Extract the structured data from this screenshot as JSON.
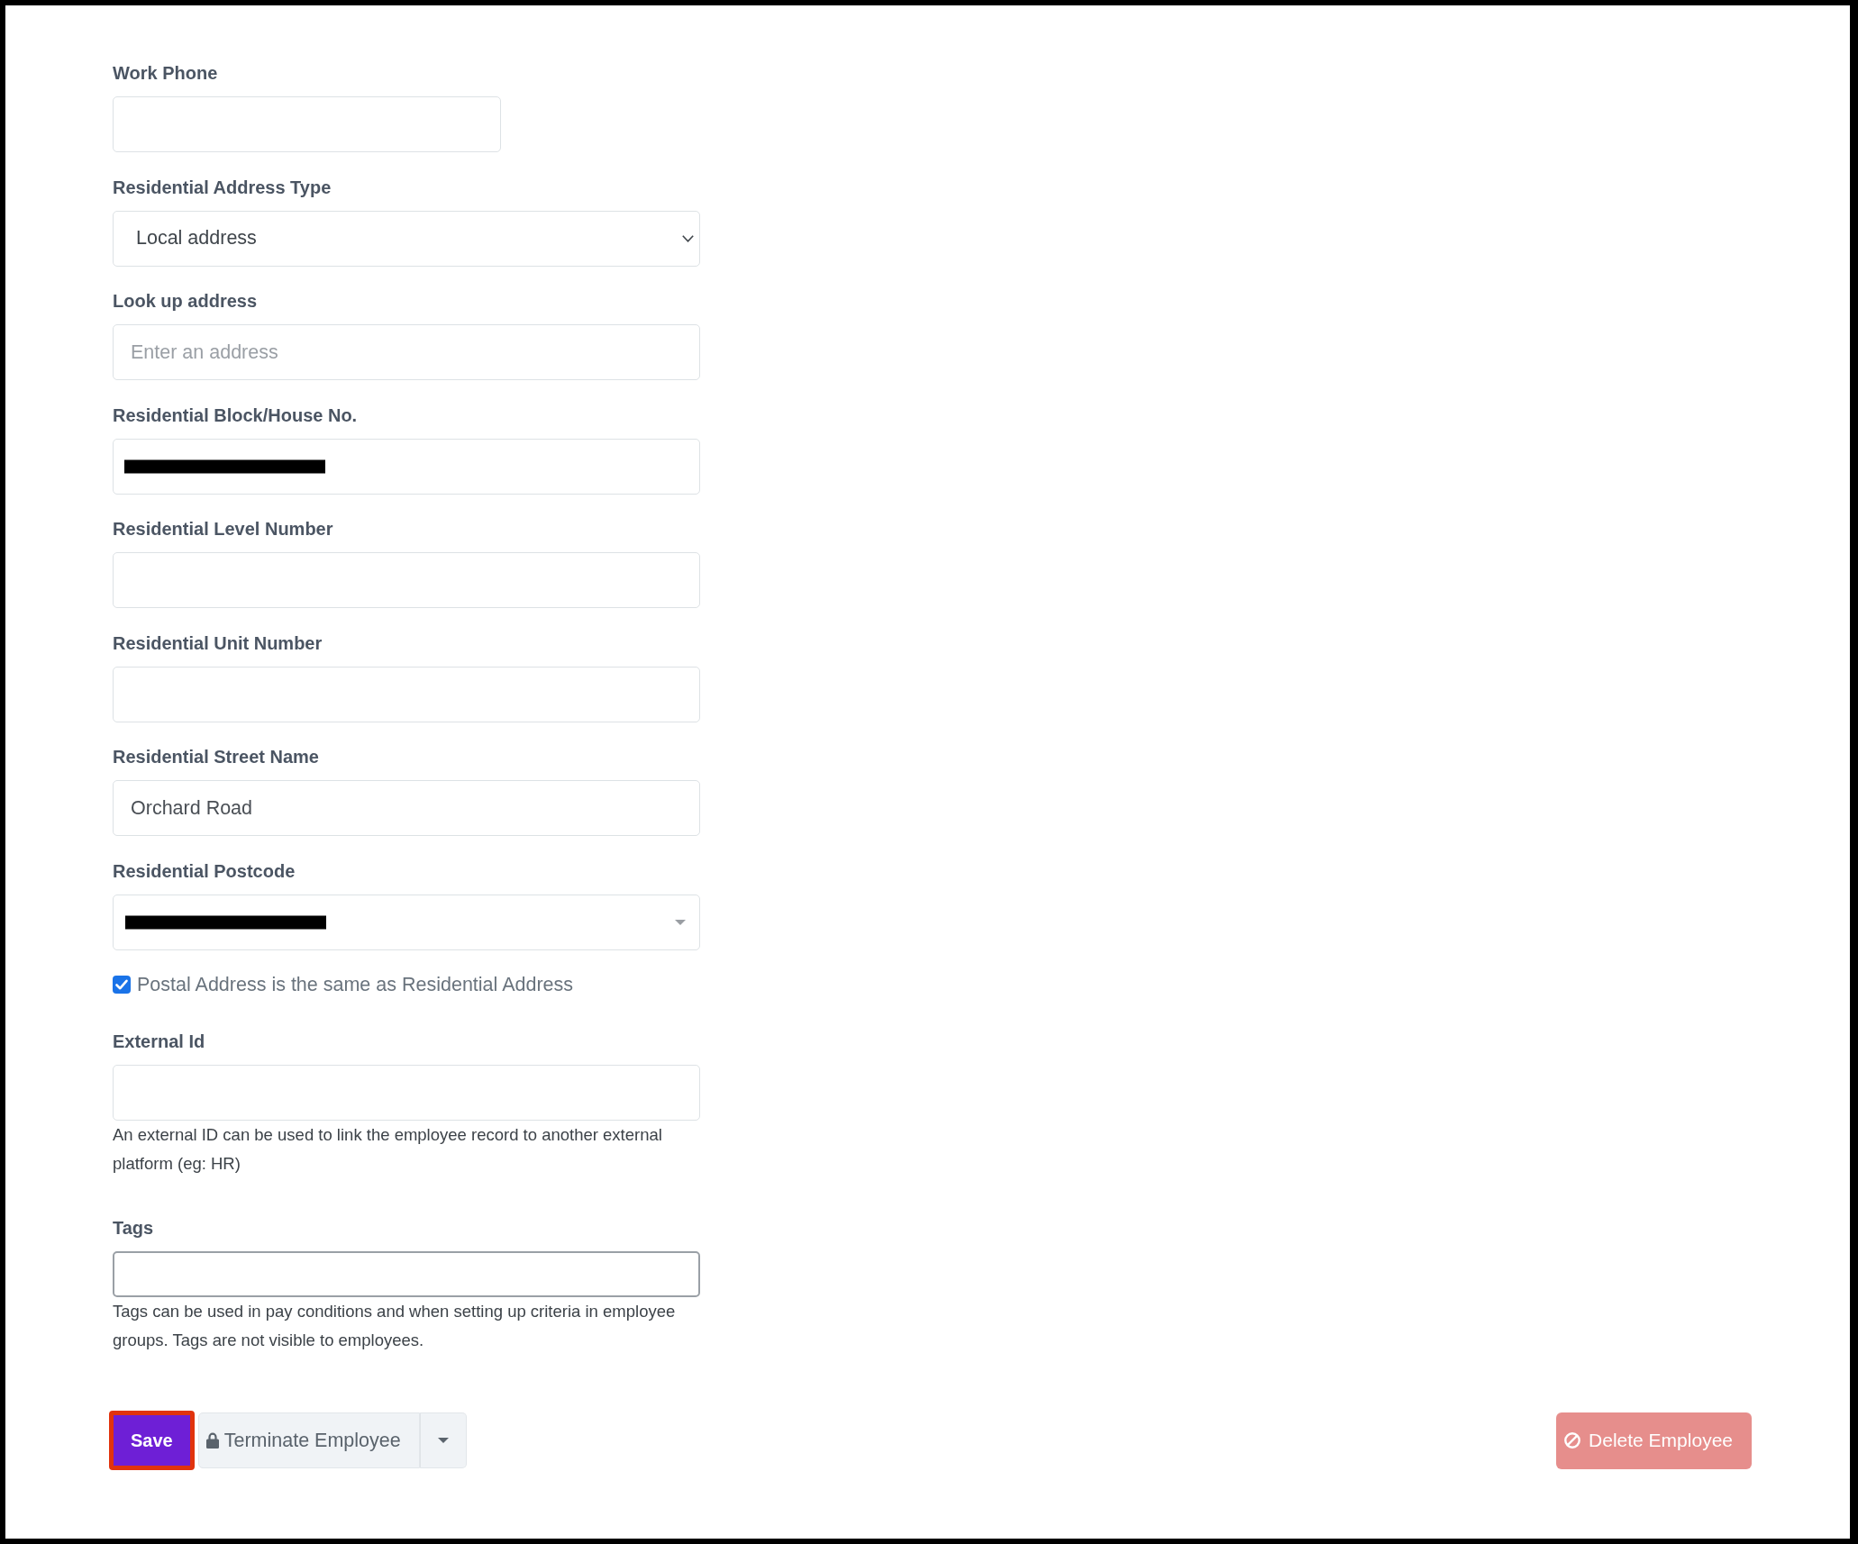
{
  "form": {
    "fields": [
      {
        "kind": "short-text",
        "label": "Work Phone",
        "redacted": false
      },
      {
        "kind": "select",
        "label": "Residential Address Type",
        "value": "Local address"
      },
      {
        "kind": "text",
        "label": "Look up address",
        "placeholder": "Enter an address",
        "redacted": false
      },
      {
        "kind": "text",
        "label": "Residential Block/House No.",
        "redacted": true
      },
      {
        "kind": "text",
        "label": "Residential Level Number",
        "redacted": false
      },
      {
        "kind": "text",
        "label": "Residential Unit Number",
        "redacted": false
      },
      {
        "kind": "text",
        "label": "Residential Street Name",
        "value": "Orchard Road",
        "redacted": false
      },
      {
        "kind": "combobox",
        "label": "Residential Postcode",
        "redacted": true
      },
      {
        "kind": "checkbox",
        "label": "Postal Address is the same as Residential Address",
        "checked": true
      },
      {
        "kind": "text",
        "label": "External Id",
        "help": "An external ID can be used to link the employee record to another external platform (eg: HR)",
        "redacted": false
      },
      {
        "kind": "tags",
        "label": "Tags",
        "help": "Tags can be used in pay conditions and when setting up criteria in employee groups. Tags are not visible to employees."
      }
    ]
  },
  "actions": [
    {
      "kind": "primary",
      "label": "Save",
      "highlighted": true,
      "disabled": false
    },
    {
      "kind": "split",
      "label": "Terminate Employee",
      "disabled": false
    },
    {
      "kind": "danger",
      "label": "Delete Employee",
      "disabled": true
    }
  ]
}
